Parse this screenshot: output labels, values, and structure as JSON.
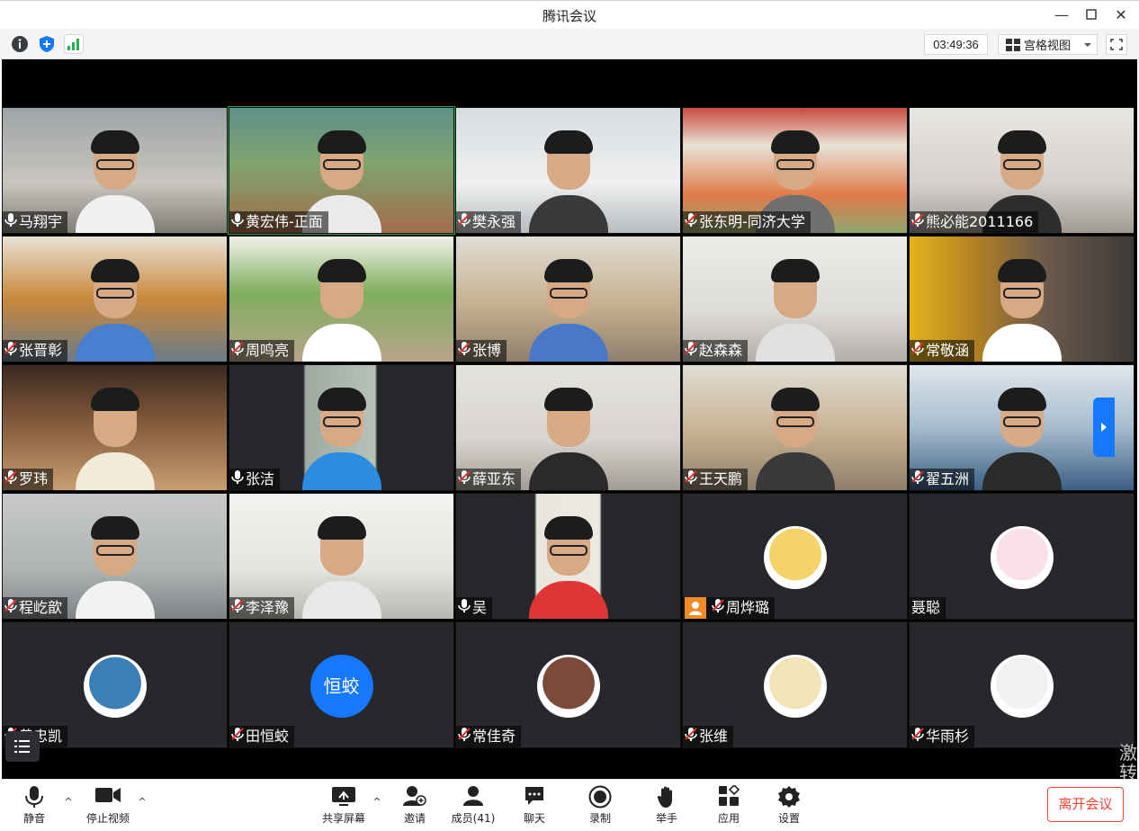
{
  "window": {
    "title": "腾讯会议",
    "minimize": "—",
    "maximize": "☐",
    "close": "✕"
  },
  "infobar": {
    "timer": "03:49:36",
    "view_label": "宫格视图"
  },
  "participants": [
    {
      "name": "马翔宇",
      "muted": false
    },
    {
      "name": "黄宏伟-正面",
      "muted": false
    },
    {
      "name": "樊永强",
      "muted": true
    },
    {
      "name": "张东明-同济大学",
      "muted": true
    },
    {
      "name": "熊必能2011166",
      "muted": true
    },
    {
      "name": "张晋彰",
      "muted": true
    },
    {
      "name": "周鸣亮",
      "muted": true
    },
    {
      "name": "张博",
      "muted": true
    },
    {
      "name": "赵森森",
      "muted": true
    },
    {
      "name": "常敬涵",
      "muted": true
    },
    {
      "name": "罗玮",
      "muted": true
    },
    {
      "name": "张洁",
      "muted": false
    },
    {
      "name": "薛亚东",
      "muted": true
    },
    {
      "name": "王天鹏",
      "muted": true
    },
    {
      "name": "翟五洲",
      "muted": true
    },
    {
      "name": "程屹歆",
      "muted": true
    },
    {
      "name": "李泽豫",
      "muted": true
    },
    {
      "name": "吴",
      "muted": false
    },
    {
      "name": "周烨璐",
      "muted": true
    },
    {
      "name": "聂聪",
      "muted": false
    },
    {
      "name": "黄忠凯",
      "muted": true
    },
    {
      "name": "田恒蛟",
      "muted": true
    },
    {
      "name": "常佳奇",
      "muted": true
    },
    {
      "name": "张维",
      "muted": true
    },
    {
      "name": "华雨杉",
      "muted": true
    }
  ],
  "avatar_text": "恒蛟",
  "toolbar": {
    "mute": "静音",
    "stop_video": "停止视频",
    "share_screen": "共享屏幕",
    "invite": "邀请",
    "members": "成员(41)",
    "chat": "聊天",
    "record": "录制",
    "raise_hand": "举手",
    "apps": "应用",
    "settings": "设置",
    "leave": "离开会议"
  },
  "watermark": "激\n转"
}
